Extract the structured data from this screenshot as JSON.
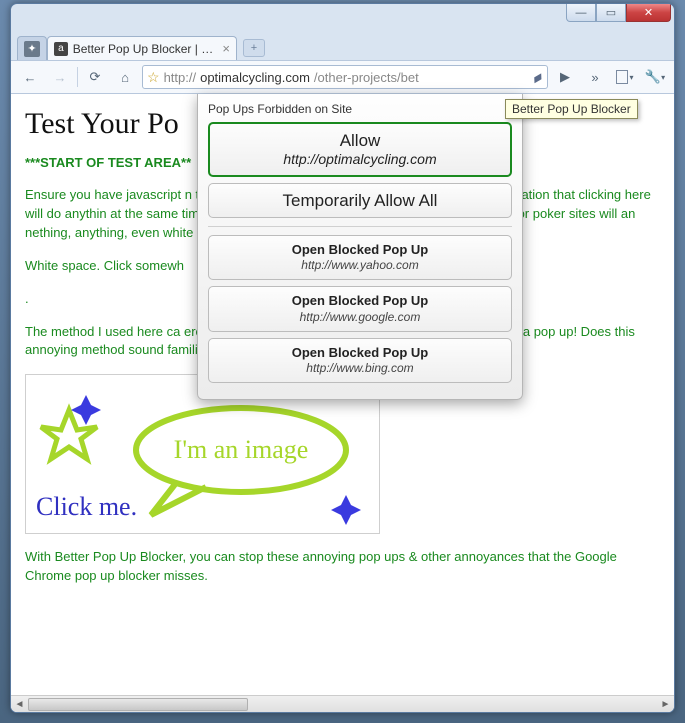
{
  "window": {
    "min": "—",
    "max": "▭",
    "close": "✕"
  },
  "tabs": {
    "page_title": "Better Pop Up Blocker | O...",
    "page_close": "×",
    "new": "+"
  },
  "toolbar": {
    "back": "←",
    "forward": "→",
    "reload": "⟳",
    "home": "⌂",
    "star": "☆",
    "url_scheme": "http://",
    "url_host": "optimalcycling.com",
    "url_path": "/other-projects/bet",
    "play": "▶",
    "chevrons": "»",
    "page_menu": "▾",
    "wrench": "🔧",
    "wrench_caret": "▾"
  },
  "popup": {
    "title": "Pop Ups Forbidden on Site",
    "allow_label": "Allow",
    "allow_site": "http://optimalcycling.com",
    "temp_label": "Temporarily Allow All",
    "blocked": [
      {
        "label": "Open Blocked Pop Up",
        "url": "http://www.yahoo.com"
      },
      {
        "label": "Open Blocked Pop Up",
        "url": "http://www.google.com"
      },
      {
        "label": "Open Blocked Pop Up",
        "url": "http://www.bing.com"
      }
    ]
  },
  "tooltip": "Better Pop Up Blocker",
  "page": {
    "heading": "Test Your Po",
    "marker": "***START OF TEST AREA**",
    "p1": "Ensure you have javascript                                                                                    n text or white space and a pop up window will o                                                                                    s no indication that clicking here will do anythin                                                                                    at the same time, but I could just as easily ha                                                                                    requently, picture, video, or poker sites will an                                                                                    nething, anything, even white space.",
    "p2": "White space. Click somewh",
    "p3": ".",
    "p4": "The method I used here ca                                                                                    ere. Hover over the image below and you will s                                                                                    will still get a pop up! Does this annoying method sound familiar?:",
    "img_bubble": "I'm an image",
    "img_click": "Click me.",
    "p5": "With Better Pop Up Blocker, you can stop these annoying pop ups & other annoyances that the Google Chrome pop up blocker misses."
  }
}
